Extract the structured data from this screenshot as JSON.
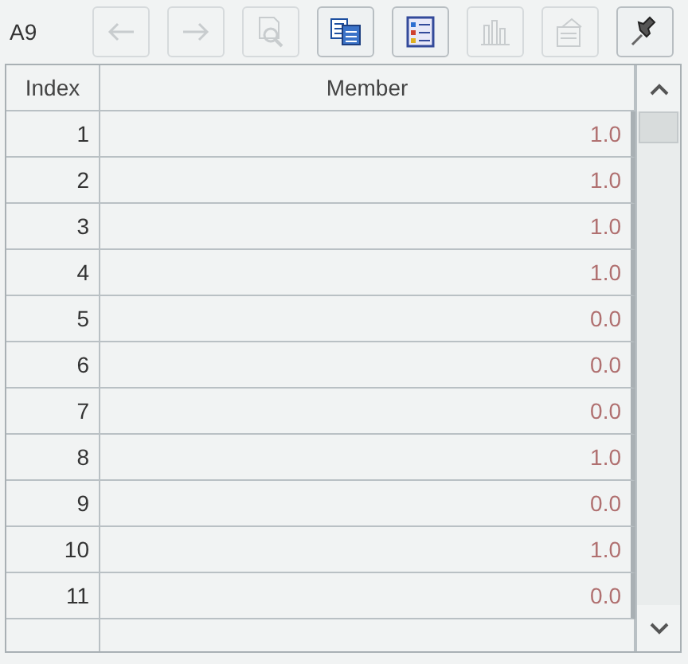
{
  "cell_reference": "A9",
  "toolbar": [
    {
      "kind": "back",
      "disabled": true
    },
    {
      "kind": "forward",
      "disabled": true
    },
    {
      "kind": "preview",
      "disabled": true
    },
    {
      "kind": "copy",
      "disabled": false
    },
    {
      "kind": "list",
      "disabled": false
    },
    {
      "kind": "chart",
      "disabled": true
    },
    {
      "kind": "properties",
      "disabled": true
    },
    {
      "kind": "pin",
      "disabled": false
    }
  ],
  "table": {
    "columns": [
      "Index",
      "Member"
    ],
    "rows": [
      [
        "1",
        "1.0"
      ],
      [
        "2",
        "1.0"
      ],
      [
        "3",
        "1.0"
      ],
      [
        "4",
        "1.0"
      ],
      [
        "5",
        "0.0"
      ],
      [
        "6",
        "0.0"
      ],
      [
        "7",
        "0.0"
      ],
      [
        "8",
        "1.0"
      ],
      [
        "9",
        "0.0"
      ],
      [
        "10",
        "1.0"
      ],
      [
        "11",
        "0.0"
      ]
    ]
  }
}
